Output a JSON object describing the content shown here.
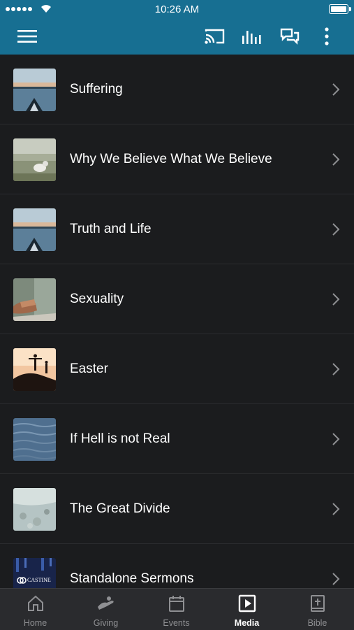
{
  "status_bar": {
    "time": "10:26 AM"
  },
  "colors": {
    "header": "#176f92",
    "background": "#1b1c1e",
    "tab_active": "#ffffff",
    "tab_inactive": "#8f9093"
  },
  "navbar": {
    "icons": [
      "menu-icon",
      "cast-icon",
      "audio-bars-icon",
      "chat-icon",
      "more-vertical-icon"
    ]
  },
  "media": {
    "items": [
      {
        "title": "Suffering",
        "thumb": "lake-kayak"
      },
      {
        "title": "Why We Believe What We Believe",
        "thumb": "dog-field"
      },
      {
        "title": "Truth and Life",
        "thumb": "lake-kayak"
      },
      {
        "title": "Sexuality",
        "thumb": "hands-rock"
      },
      {
        "title": "Easter",
        "thumb": "sunset-silhouette"
      },
      {
        "title": "If Hell is not Real",
        "thumb": "water"
      },
      {
        "title": "The Great Divide",
        "thumb": "rocky-shore"
      },
      {
        "title": "Standalone Sermons",
        "thumb": "castine-logo",
        "thumb_text": "CASTINE"
      }
    ]
  },
  "tabs": [
    {
      "label": "Home",
      "icon": "home-icon"
    },
    {
      "label": "Giving",
      "icon": "giving-icon"
    },
    {
      "label": "Events",
      "icon": "calendar-icon"
    },
    {
      "label": "Media",
      "icon": "media-play-icon",
      "active": true
    },
    {
      "label": "Bible",
      "icon": "bible-icon"
    }
  ]
}
